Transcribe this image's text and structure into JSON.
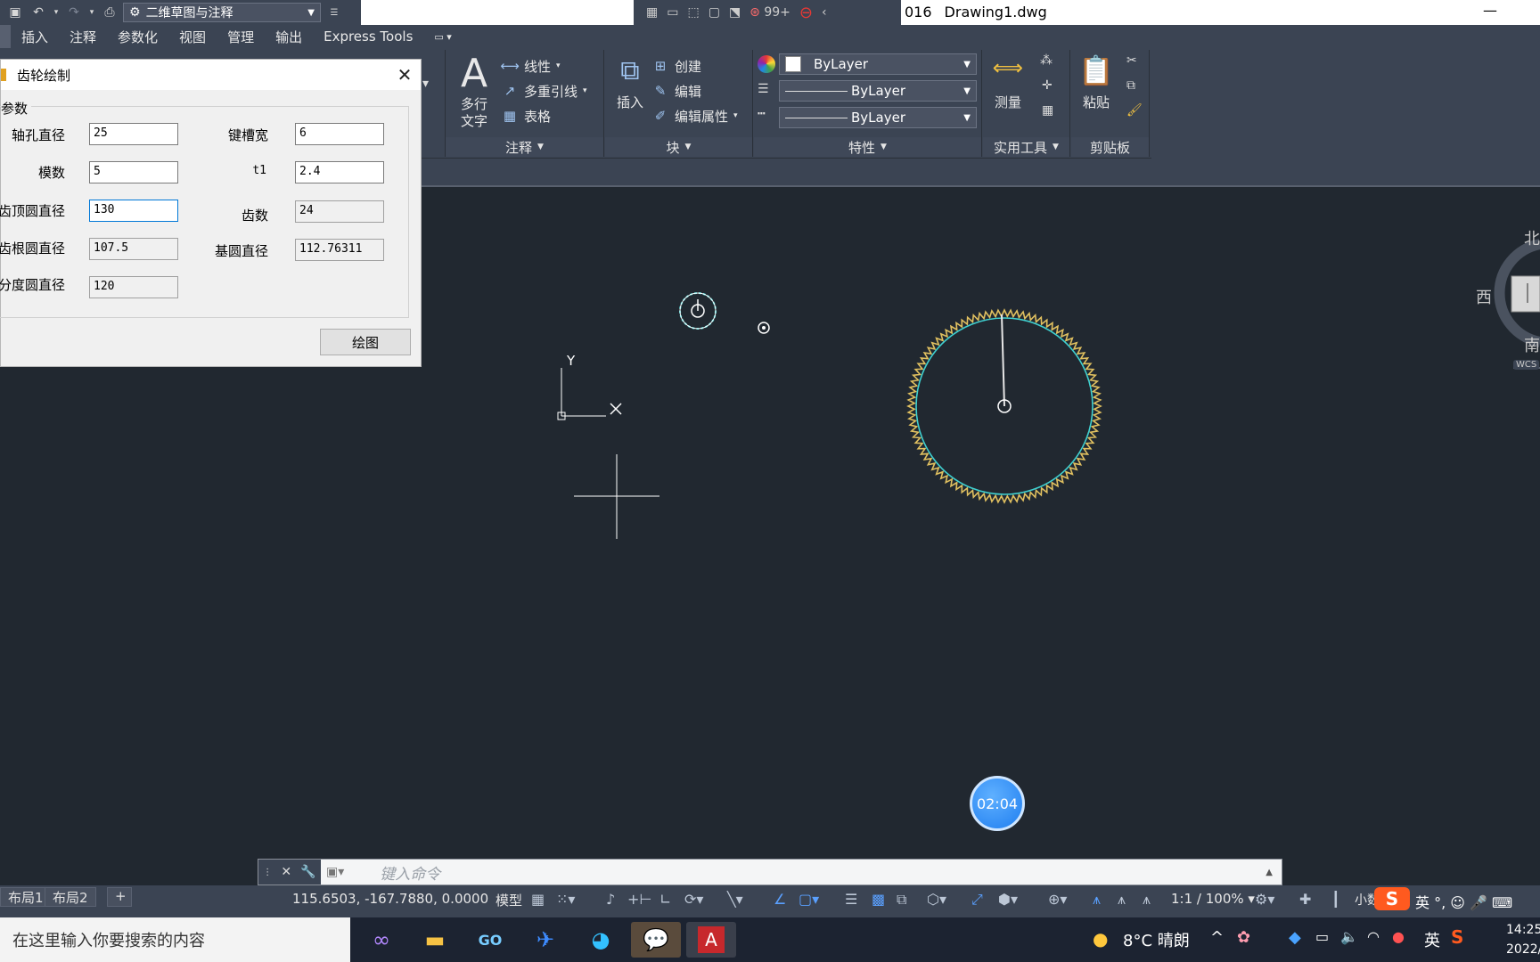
{
  "titlebar": {
    "workspace": "二维草图与注释",
    "filename_part": "016",
    "filename": "Drawing1.dwg",
    "notification_count": "99+",
    "minimize": "—"
  },
  "ribbon_tabs": [
    "插入",
    "注释",
    "参数化",
    "视图",
    "管理",
    "输出",
    "Express Tools"
  ],
  "ribbon": {
    "annotation": {
      "mtext_label_1": "多行",
      "mtext_label_2": "文字",
      "linear": "线性",
      "multileader": "多重引线",
      "table": "表格",
      "group_label": "注释"
    },
    "block": {
      "insert": "插入",
      "create": "创建",
      "edit": "编辑",
      "edit_attr": "编辑属性",
      "group_label": "块"
    },
    "properties": {
      "color": "ByLayer",
      "linetype": "ByLayer",
      "lineweight": "ByLayer",
      "group_label": "特性"
    },
    "utilities": {
      "measure": "测量",
      "group_label": "实用工具"
    },
    "clipboard": {
      "paste": "粘贴",
      "group_label": "剪贴板"
    }
  },
  "dialog": {
    "title": "齿轮绘制",
    "group_label": "参数",
    "fields": {
      "bore_label": "轴孔直径",
      "bore_value": "25",
      "keyway_label": "键槽宽",
      "keyway_value": "6",
      "module_label": "模数",
      "module_value": "5",
      "t1_label": "t1",
      "t1_value": "2.4",
      "tip_label": "齿顶圆直径",
      "tip_value": "130",
      "teeth_label": "齿数",
      "teeth_value": "24",
      "root_label": "齿根圆直径",
      "root_value": "107.5",
      "base_label": "基圆直径",
      "base_value": "112.76311",
      "pitch_label": "分度圆直径",
      "pitch_value": "120"
    },
    "draw_button": "绘图"
  },
  "canvas": {
    "ucs_y": "Y",
    "ucs_x": "X",
    "viewcube": {
      "north": "北",
      "west": "西",
      "south": "南",
      "wcs": "WCS"
    }
  },
  "timer": "02:04",
  "command": {
    "placeholder": "键入命令"
  },
  "status": {
    "layout_tabs": [
      "布局1",
      "布局2"
    ],
    "add_tab": "+",
    "coords": "115.6503, -167.7880, 0.0000",
    "model": "模型",
    "scale": "1:1 / 100%",
    "small": "小数"
  },
  "taskbar": {
    "search_placeholder": "在这里输入你要搜索的内容",
    "weather": "8°C  晴朗",
    "ime": "英",
    "time": "14:25",
    "date": "2022/"
  },
  "colors": {
    "ribbon_bg": "#3b4453",
    "canvas_bg": "#212830",
    "gear_outline": "#e0c060",
    "gear_circle": "#3fd0d0",
    "accent": "#0078d7"
  }
}
